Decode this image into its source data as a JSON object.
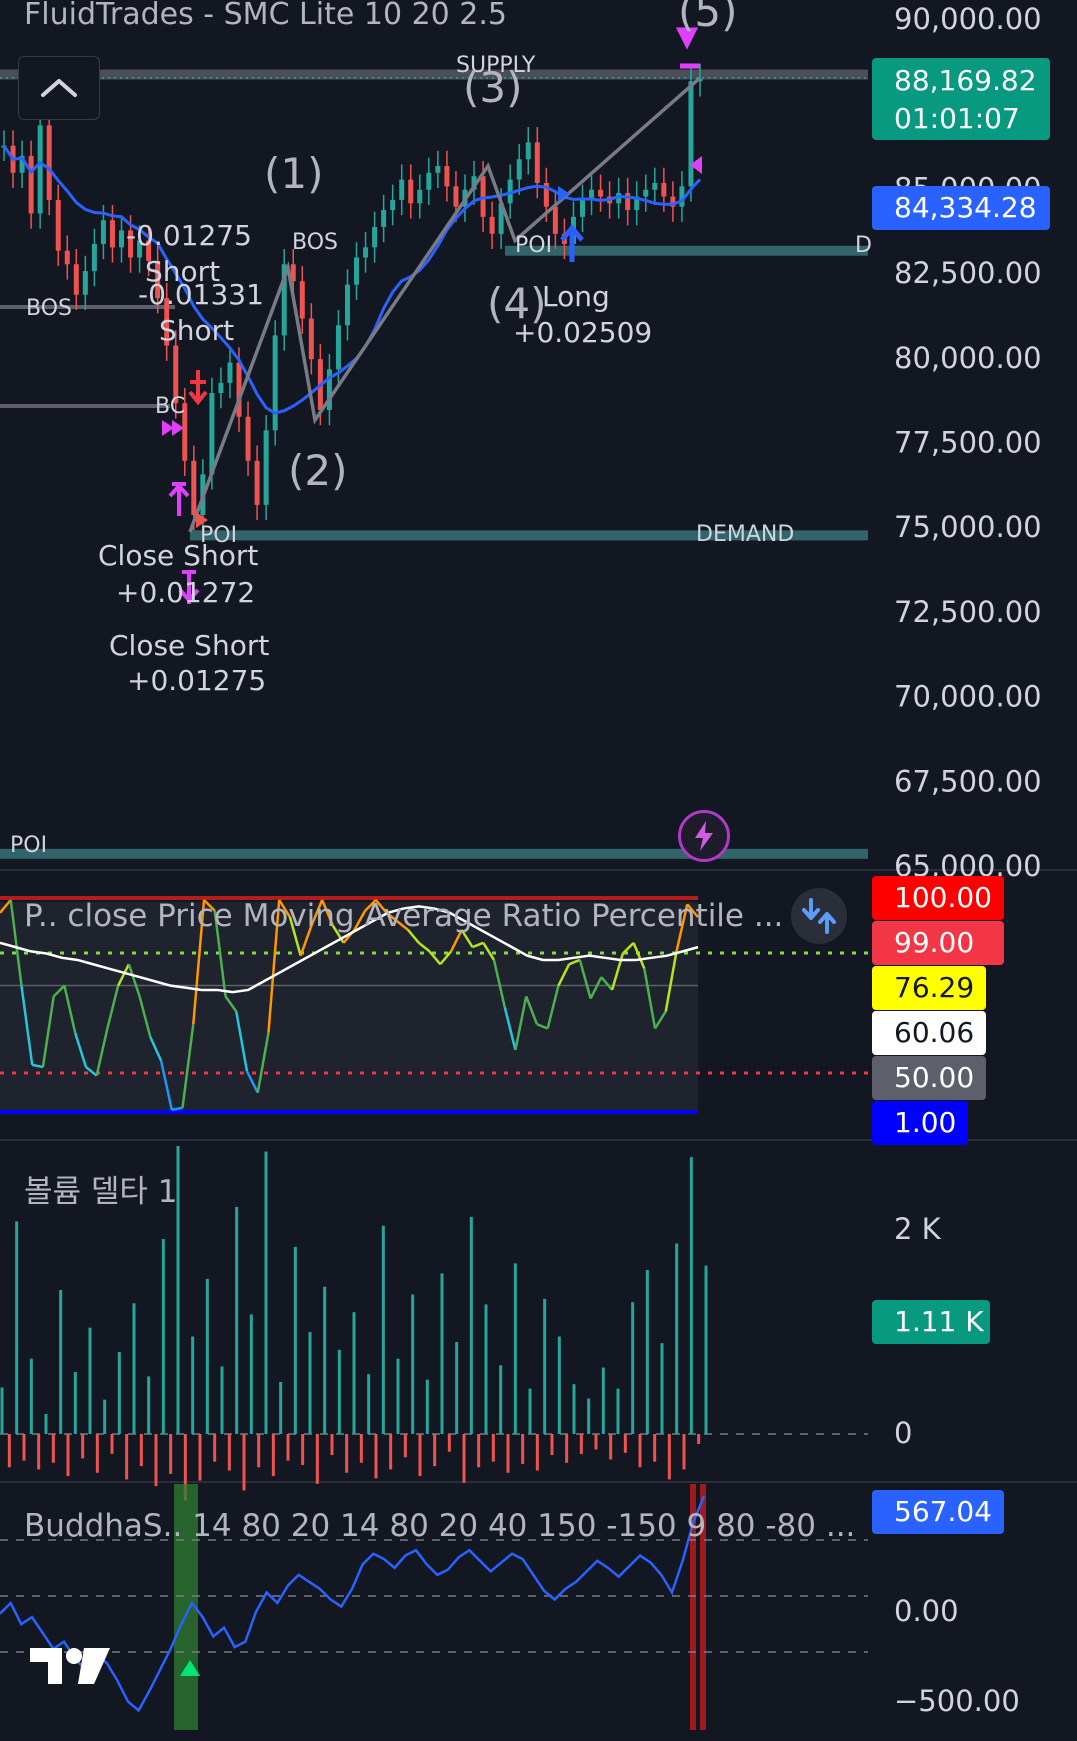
{
  "chart_title": "FluidTrades - SMC Lite 10 20 2.5",
  "chart_data": [
    {
      "type": "candlestick",
      "title": "FluidTrades - SMC Lite 10 20 2.5",
      "y_ticks": [
        90000,
        85000,
        82500,
        80000,
        77500,
        75000,
        72500,
        70000,
        67500,
        65000
      ],
      "y_tick_labels": [
        "90,000.00",
        "85,000.00",
        "82,500.00",
        "80,000.00",
        "77,500.00",
        "75,000.00",
        "72,500.00",
        "70,000.00",
        "67,500.00",
        "65,000.00"
      ],
      "ylim": [
        65000,
        90500
      ],
      "last_price": "88,169.82",
      "countdown": "01:01:07",
      "ma_value": "84,334.28",
      "zones": [
        {
          "label": "SUPPLY",
          "level": 88300
        },
        {
          "label": "DEMAND",
          "level": 74700
        },
        {
          "label": "POI",
          "level": 83100
        },
        {
          "label": "POI",
          "level": 65300
        }
      ],
      "bos_labels": [
        "BOS",
        "BOS"
      ],
      "wave_labels": [
        "(1)",
        "(2)",
        "(3)",
        "(4)",
        "(5)"
      ],
      "annotations": [
        "-0.01275",
        "Short",
        "-0.01331",
        "Short",
        "Close Short",
        "+0.01272",
        "Close Short",
        "+0.01275",
        "Long",
        "+0.02509",
        "BC",
        "POI",
        "POI",
        "D"
      ],
      "close_series": [
        86200,
        85400,
        85900,
        84200,
        86800,
        84600,
        83100,
        82700,
        81800,
        82500,
        83300,
        84000,
        83200,
        83700,
        82900,
        83400,
        82800,
        81700,
        80300,
        78600,
        76900,
        75300,
        76500,
        78900,
        79200,
        79800,
        78200,
        76900,
        75600,
        77800,
        80600,
        82700,
        82200,
        81100,
        79900,
        78400,
        79600,
        80900,
        82100,
        82900,
        83200,
        83800,
        84300,
        84600,
        85200,
        84500,
        84900,
        85400,
        85600,
        85000,
        84400,
        84900,
        85300,
        84100,
        83600,
        84500,
        85200,
        85800,
        86300,
        85100,
        84400,
        83600,
        83300,
        84100,
        84600,
        84900,
        84700,
        84500,
        84800,
        84300,
        84700,
        84900,
        85100,
        84700,
        84400,
        85000,
        88100,
        88170
      ]
    },
    {
      "type": "line",
      "title": "P.. close Price Moving Average Ratio Percentile ...",
      "ylim": [
        1,
        100
      ],
      "levels": [
        {
          "label": "100.00",
          "value": 100,
          "color": "#ff0000"
        },
        {
          "label": "99.00",
          "value": 99,
          "color": "#f23645"
        },
        {
          "label": "76.29",
          "value": 76.29,
          "color": "#ffff00"
        },
        {
          "label": "60.06",
          "value": 60.06,
          "color": "#ffffff"
        },
        {
          "label": "50.00",
          "value": 50,
          "color": "#5d606b"
        },
        {
          "label": "1.00",
          "value": 1,
          "color": "#0000ff"
        }
      ],
      "percentile": [
        94,
        100,
        60,
        23,
        22,
        55,
        60,
        38,
        22,
        18,
        40,
        60,
        70,
        55,
        36,
        25,
        2,
        3,
        42,
        100,
        95,
        55,
        48,
        20,
        10,
        38,
        100,
        92,
        74,
        88,
        100,
        88,
        80,
        86,
        95,
        100,
        94,
        90,
        86,
        80,
        76,
        70,
        76,
        86,
        78,
        80,
        72,
        50,
        30,
        55,
        42,
        40,
        60,
        70,
        72,
        54,
        64,
        58,
        75,
        80,
        68,
        40,
        48,
        76,
        98,
        92
      ],
      "signal": [
        80,
        78,
        76,
        75,
        73,
        72,
        70,
        68,
        66,
        64,
        62,
        60,
        59,
        58,
        58,
        57,
        58,
        62,
        66,
        70,
        74,
        78,
        82,
        86,
        90,
        94,
        96,
        97,
        96,
        94,
        90,
        86,
        82,
        78,
        74,
        72,
        72,
        73,
        74,
        73,
        72,
        72,
        73,
        74,
        76,
        78
      ]
    },
    {
      "type": "bar",
      "title": "볼륨 델타 1",
      "y_tick_labels": [
        "2 K",
        "0"
      ],
      "last_value": "1.11 K",
      "ylim": [
        -500,
        2600
      ],
      "values": [
        420,
        -300,
        1920,
        -240,
        680,
        -320,
        180,
        -260,
        1300,
        -380,
        560,
        -220,
        960,
        -350,
        310,
        -180,
        740,
        -410,
        1180,
        -290,
        520,
        -470,
        1760,
        -360,
        2600,
        -600,
        880,
        -420,
        1400,
        -250,
        610,
        -330,
        2050,
        -510,
        1080,
        -300,
        2550,
        -380,
        470,
        -240,
        1690,
        -280,
        920,
        -450,
        1330,
        -190,
        760,
        -350,
        1100,
        -260,
        540,
        -400,
        1880,
        -320,
        680,
        -210,
        1260,
        -380,
        490,
        -290,
        1450,
        -160,
        830,
        -440,
        1960,
        -300,
        1170,
        -250,
        620,
        -350,
        1540,
        -270,
        410,
        -330,
        1220,
        -190,
        880,
        -260,
        450,
        -180,
        320,
        -140,
        600,
        -230,
        410,
        -170,
        1190,
        -300,
        1480,
        -250,
        820,
        -410,
        1720,
        -320,
        2500,
        -90,
        1520
      ]
    },
    {
      "type": "line",
      "title": "BuddhaS.. 14 80 20 14 80 20 40 150 -150 9 80 -80 ...",
      "y_tick_labels": [
        "0.00",
        "−500.00"
      ],
      "last_value": "567.04",
      "ylim": [
        -700,
        700
      ],
      "values": [
        -100,
        -40,
        -160,
        -120,
        -210,
        -300,
        -260,
        -350,
        -420,
        -330,
        -380,
        -480,
        -600,
        -650,
        -540,
        -420,
        -300,
        -160,
        -40,
        -120,
        -230,
        -180,
        -290,
        -260,
        -90,
        20,
        -40,
        60,
        120,
        80,
        40,
        -20,
        -60,
        40,
        180,
        240,
        210,
        160,
        230,
        260,
        180,
        120,
        150,
        220,
        260,
        200,
        140,
        190,
        240,
        210,
        120,
        30,
        -20,
        40,
        80,
        140,
        200,
        160,
        110,
        170,
        230,
        190,
        120,
        20,
        200,
        420,
        567
      ]
    }
  ],
  "colors": {
    "background": "#131722",
    "up": "#26a69a",
    "down": "#ef5350",
    "ma": "#2962ff",
    "zone": "#4fb3b0",
    "magenta": "#e040fb",
    "axis_text": "#d1d4dc"
  },
  "icons": {
    "collapse": "chevron-up-icon",
    "restore": "swap-arrows-icon",
    "replay": "lightning-icon",
    "logo": "tradingview-logo-icon"
  }
}
